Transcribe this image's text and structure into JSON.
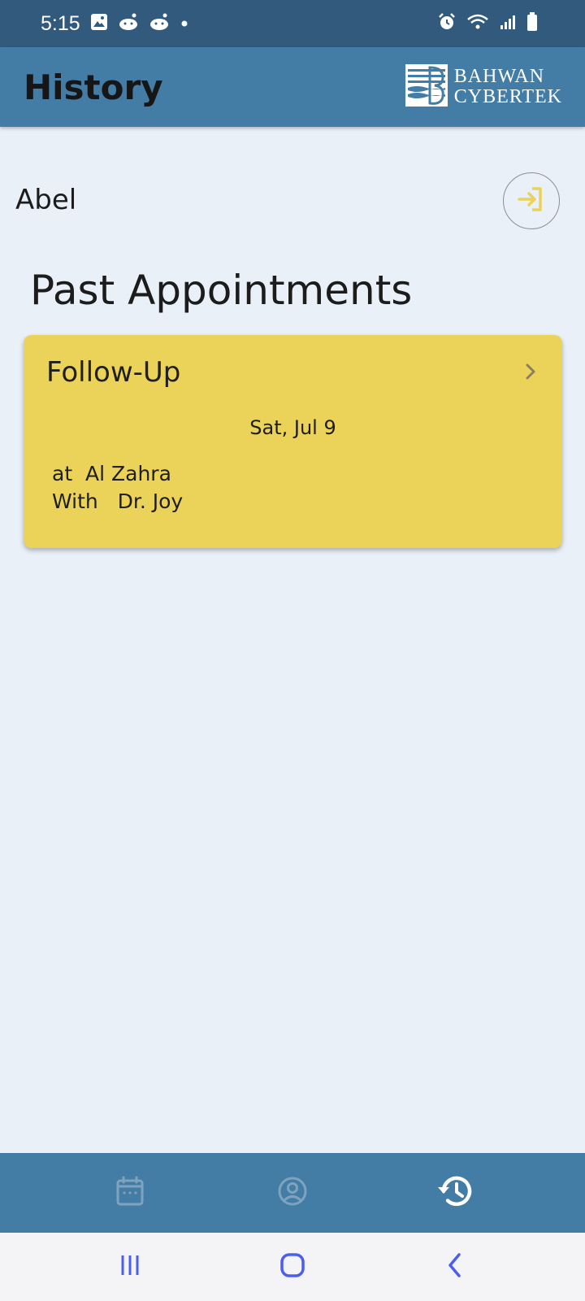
{
  "status_bar": {
    "time": "5:15",
    "left_icons": [
      "image-icon",
      "reddit-icon",
      "reddit-icon",
      "dot-icon"
    ],
    "right_icons": [
      "alarm-icon",
      "wifi-icon",
      "signal-icon",
      "battery-icon"
    ]
  },
  "app_bar": {
    "title": "History",
    "brand_line1": "Bahwan",
    "brand_line2": "CyberTek"
  },
  "user": {
    "name": "Abel",
    "logout_icon": "logout-icon"
  },
  "section_title": "Past Appointments",
  "appointments": [
    {
      "title": "Follow-Up",
      "date": "Sat, Jul 9",
      "location_line": "at  Al Zahra",
      "doctor_line": "With   Dr. Joy"
    }
  ],
  "bottom_nav": {
    "items": [
      {
        "icon": "calendar-icon",
        "active": false
      },
      {
        "icon": "profile-icon",
        "active": false
      },
      {
        "icon": "history-icon",
        "active": true
      }
    ]
  },
  "system_nav": [
    "recents-icon",
    "home-icon",
    "back-icon"
  ],
  "colors": {
    "status_bar": "#325a7c",
    "app_bar": "#437ca4",
    "background": "#eaf0f8",
    "card": "#ebd258",
    "accent": "#ebd258",
    "nav_inactive": "#7fa3bf",
    "system_nav_icon": "#4a5ff0"
  }
}
